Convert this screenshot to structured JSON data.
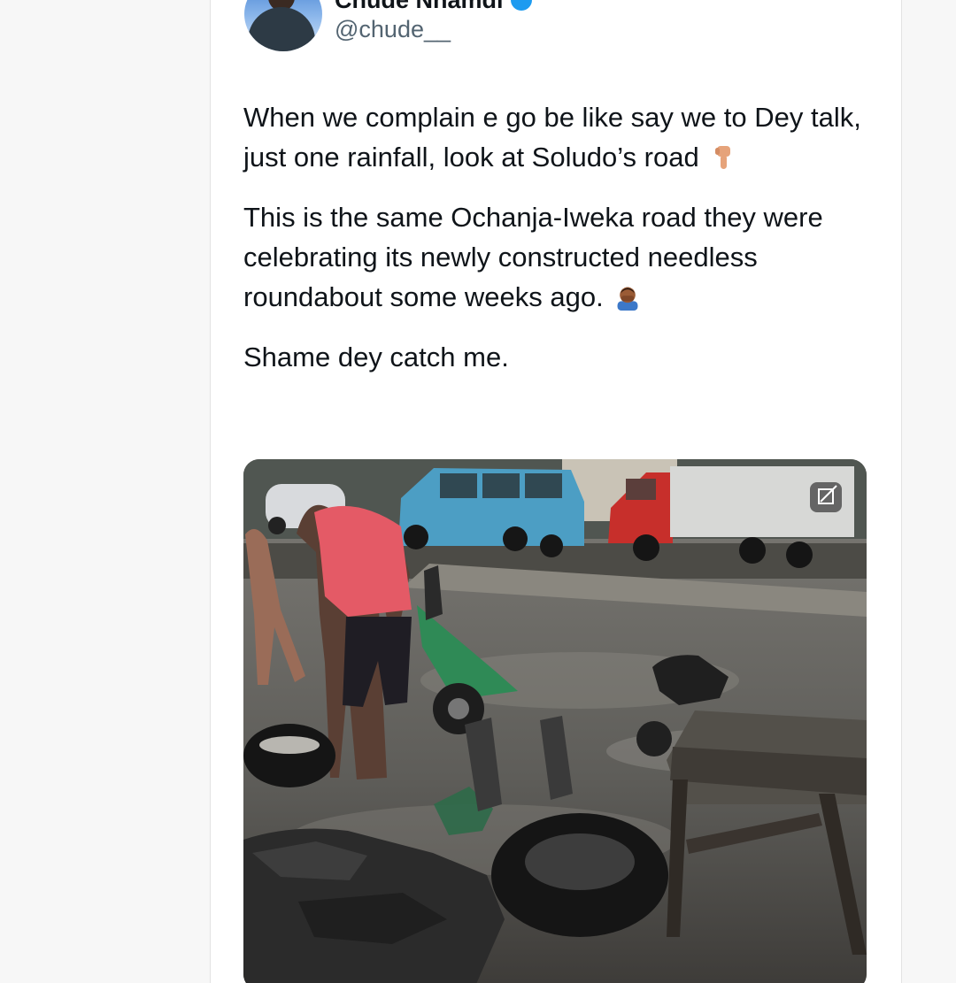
{
  "tweet": {
    "display_name": "Chude Nnamdi",
    "handle": "@chude__",
    "paragraphs": [
      "When we complain e go be like say we to Dey talk, just one rainfall, look at Soludo’s road",
      "This is the same Ochanja-Iweka road they were celebrating its newly constructed needless roundabout some weeks ago.",
      "Shame dey catch me."
    ],
    "emoji_1": "backhand-index-pointing-down-emoji",
    "emoji_2": "man-facepalming-emoji",
    "media_icon": "alt-text-badge-icon"
  },
  "colors": {
    "verified": "#1d9bf0",
    "handle": "#536471",
    "text": "#0f1419"
  }
}
